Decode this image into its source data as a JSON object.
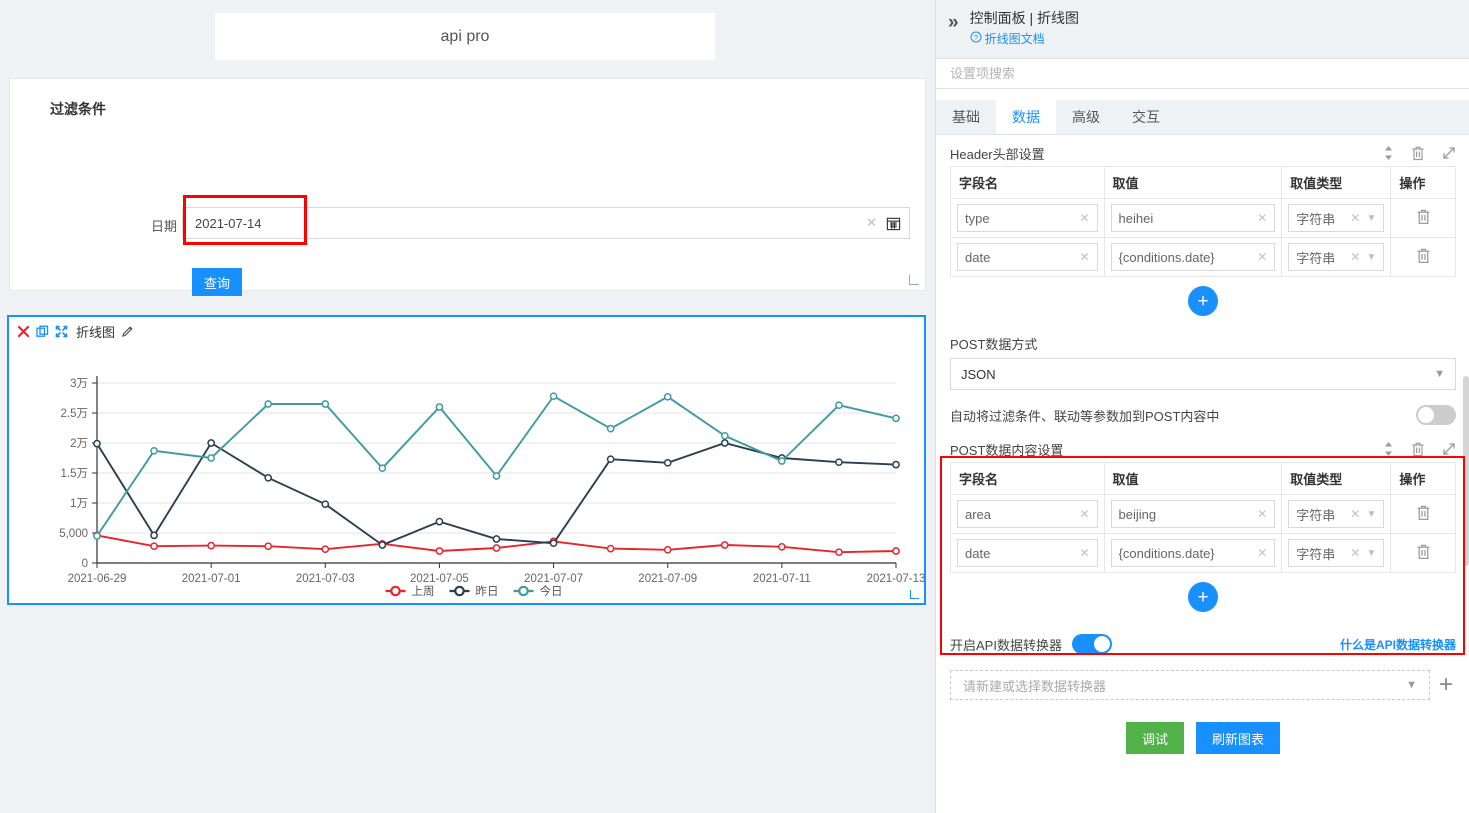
{
  "canvas": {
    "board_title": "api pro",
    "filter": {
      "title": "过滤条件",
      "date_label": "日期",
      "date_value": "2021-07-14",
      "date_clear_icon": "close-icon",
      "calendar_icon": "calendar-icon",
      "query_button": "查询"
    },
    "chart_widget": {
      "name": "折线图",
      "toolbar_icons": [
        "close-icon",
        "copy-icon",
        "fullscreen-icon",
        "edit-pencil-icon"
      ]
    }
  },
  "chart_data": {
    "type": "line",
    "title": "",
    "xlabel": "",
    "ylabel": "",
    "grid": true,
    "legend_position": "bottom",
    "ylim": [
      0,
      30000
    ],
    "ytick_labels": [
      "0",
      "5,000",
      "1万",
      "1.5万",
      "2万",
      "2.5万",
      "3万"
    ],
    "ytick_values": [
      0,
      5000,
      10000,
      15000,
      20000,
      25000,
      30000
    ],
    "x": [
      "2021-06-29",
      "2021-06-30",
      "2021-07-01",
      "2021-07-02",
      "2021-07-03",
      "2021-07-04",
      "2021-07-05",
      "2021-07-06",
      "2021-07-07",
      "2021-07-08",
      "2021-07-09",
      "2021-07-10",
      "2021-07-11",
      "2021-07-12",
      "2021-07-13"
    ],
    "xtick_labels": [
      "2021-06-29",
      "2021-07-01",
      "2021-07-03",
      "2021-07-05",
      "2021-07-07",
      "2021-07-09",
      "2021-07-11",
      "2021-07-13"
    ],
    "xtick_indices": [
      0,
      2,
      4,
      6,
      8,
      10,
      12,
      14
    ],
    "series": [
      {
        "name": "上周",
        "color": "#e8242c",
        "values": [
          4600,
          2800,
          2900,
          2800,
          2300,
          3200,
          2000,
          2500,
          3600,
          2400,
          2200,
          3000,
          2700,
          1800,
          2000
        ]
      },
      {
        "name": "昨日",
        "color": "#2b3f51",
        "values": [
          19900,
          4600,
          20000,
          14200,
          9800,
          3000,
          6900,
          4000,
          3300,
          17300,
          16700,
          20000,
          17500,
          16800,
          16400
        ]
      },
      {
        "name": "今日",
        "color": "#3f9ba1",
        "values": [
          4500,
          18700,
          17500,
          26500,
          26500,
          15800,
          26000,
          14500,
          27800,
          22400,
          27700,
          21200,
          17000,
          26300,
          24100
        ]
      }
    ]
  },
  "panel": {
    "collapse_icon": "double-chevron-right-icon",
    "title": "控制面板 | 折线图",
    "doc_icon": "question-circle-icon",
    "doc_link": "折线图文档",
    "search_placeholder": "设置项搜索",
    "tabs": [
      {
        "label": "基础",
        "active": false
      },
      {
        "label": "数据",
        "active": true
      },
      {
        "label": "高级",
        "active": false
      },
      {
        "label": "交互",
        "active": false
      }
    ],
    "section_icons": {
      "sort": "sort-updown-icon",
      "delete": "trash-icon",
      "expand": "expand-diagonal-icon"
    },
    "header_section": {
      "title": "Header头部设置",
      "columns": [
        "字段名",
        "取值",
        "取值类型",
        "操作"
      ],
      "rows": [
        {
          "field": "type",
          "value": "heihei",
          "type": "字符串"
        },
        {
          "field": "date",
          "value": "{conditions.date}",
          "type": "字符串"
        }
      ],
      "add_label": "+"
    },
    "post_method": {
      "label": "POST数据方式",
      "value": "JSON"
    },
    "auto_params": {
      "label": "自动将过滤条件、联动等参数加到POST内容中",
      "enabled": false
    },
    "post_section": {
      "title": "POST数据内容设置",
      "columns": [
        "字段名",
        "取值",
        "取值类型",
        "操作"
      ],
      "rows": [
        {
          "field": "area",
          "value": "beijing",
          "type": "字符串"
        },
        {
          "field": "date",
          "value": "{conditions.date}",
          "type": "字符串"
        }
      ],
      "add_label": "+"
    },
    "converter": {
      "label": "开启API数据转换器",
      "enabled": true,
      "help_link": "什么是API数据转换器",
      "select_placeholder": "请新建或选择数据转换器",
      "add_icon": "plus-icon"
    },
    "actions": {
      "debug": "调试",
      "refresh": "刷新图表"
    }
  },
  "colors": {
    "accent": "#1890ff",
    "green": "#52b24a",
    "highlight": "#ff0000"
  }
}
